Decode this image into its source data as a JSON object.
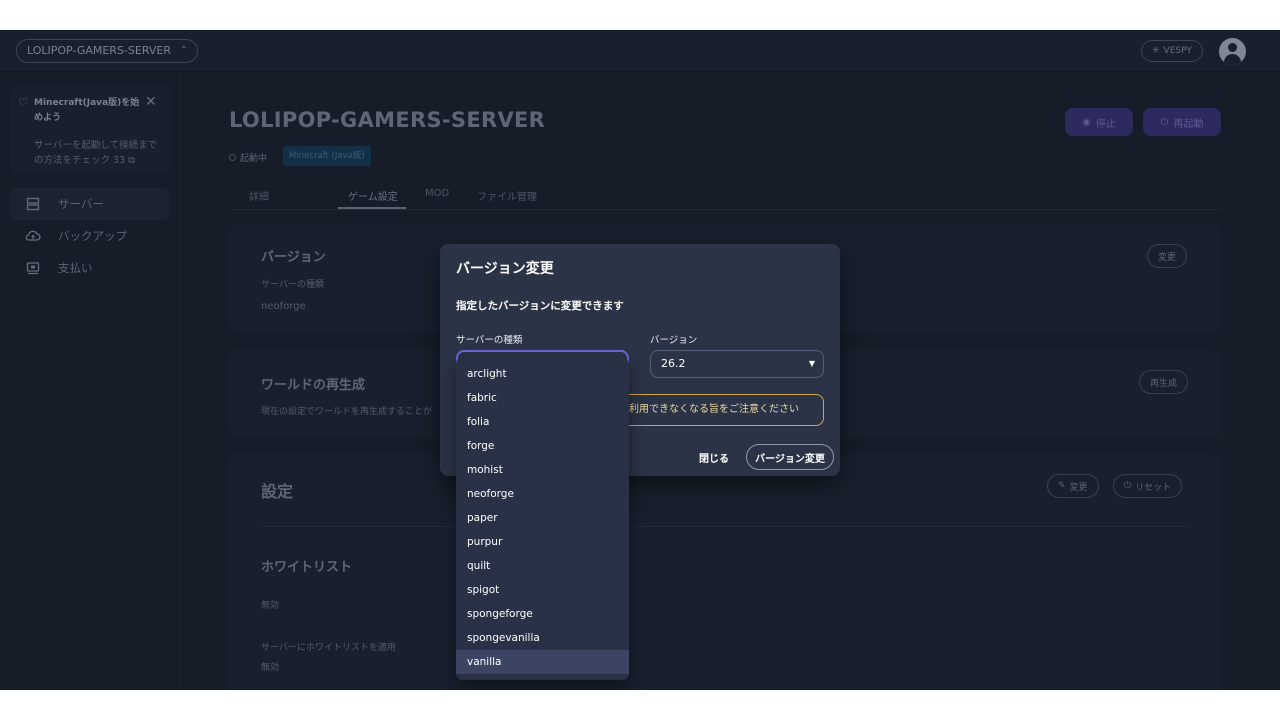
{
  "topbar": {
    "server_select": "LOLIPOP-GAMERS-SERVER",
    "user_badge": "VESPY"
  },
  "sidebar": {
    "tip_title": "Minecraft(Java版)を始めよう",
    "tip_body": "サーバーを起動して接続までの方法をチェック",
    "tip_badge": "33",
    "items": [
      {
        "label": "サーバー",
        "icon": "server-icon"
      },
      {
        "label": "バックアップ",
        "icon": "cloud-backup-icon"
      },
      {
        "label": "支払い",
        "icon": "payment-icon"
      }
    ]
  },
  "server": {
    "title": "LOLIPOP-GAMERS-SERVER",
    "status": "起動中",
    "edition": "Minecraft (Java版)",
    "stop_label": "停止",
    "restart_label": "再起動"
  },
  "tabs": [
    "詳細",
    "ゲーム設定",
    "MOD",
    "ファイル管理"
  ],
  "version_card": {
    "title": "バージョン",
    "type_label": "サーバーの種類",
    "type_value": "neoforge",
    "change_label": "変更"
  },
  "regen_card": {
    "title": "ワールドの再生成",
    "desc": "現在の設定でワールドを再生成することが",
    "button": "再生成"
  },
  "settings_card": {
    "title": "設定",
    "edit_label": "変更",
    "reset_label": "リセット",
    "whitelist_title": "ホワイトリスト",
    "whitelist_value": "無効",
    "apply_whitelist_label": "サーバーにホワイトリストを適用",
    "apply_whitelist_value": "無効"
  },
  "dialog": {
    "title": "バージョン変更",
    "description": "指定したバージョンに変更できます",
    "type_label": "サーバーの種類",
    "version_label": "バージョン",
    "version_value": "26.2",
    "warning": "利用できなくなる旨をご注意ください",
    "close_label": "閉じる",
    "submit_label": "バージョン変更"
  },
  "dropdown": {
    "options": [
      "arclight",
      "fabric",
      "folia",
      "forge",
      "mohist",
      "neoforge",
      "paper",
      "purpur",
      "quilt",
      "spigot",
      "spongeforge",
      "spongevanilla",
      "vanilla"
    ],
    "highlighted": "vanilla"
  }
}
